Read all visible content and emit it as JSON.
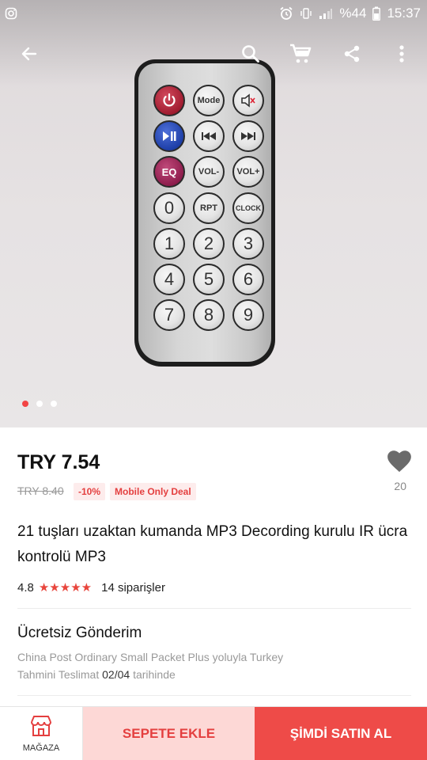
{
  "status_bar": {
    "battery_text": "%44",
    "time": "15:37",
    "icons": [
      "instagram-icon",
      "alarm-icon",
      "vibrate-icon",
      "signal-icon",
      "battery-icon"
    ]
  },
  "nav": {
    "icons": [
      "back-arrow-icon",
      "search-icon",
      "cart-icon",
      "share-icon",
      "more-vert-icon"
    ]
  },
  "gallery": {
    "page_count": 3,
    "active_index": 0,
    "remote_labels": {
      "mode": "Mode",
      "eq": "EQ",
      "vol_minus": "VOL-",
      "vol_plus": "VOL+",
      "zero": "0",
      "rpt": "RPT",
      "clock": "CLOCK",
      "n1": "1",
      "n2": "2",
      "n3": "3",
      "n4": "4",
      "n5": "5",
      "n6": "6",
      "n7": "7",
      "n8": "8",
      "n9": "9"
    }
  },
  "product": {
    "price": "TRY 7.54",
    "old_price": "TRY 8.40",
    "discount": "-10%",
    "deal_badge": "Mobile Only Deal",
    "wishlist_count": "20",
    "title": "21 tuşları uzaktan kumanda MP3 Decording kurulu IR ücra kontrolü MP3",
    "rating": "4.8",
    "stars": "★★★★★",
    "orders": "14 siparişler"
  },
  "shipping": {
    "title": "Ücretsiz Gönderim",
    "method": "China Post Ordinary Small Packet Plus yoluyla Turkey",
    "eta_prefix": "Tahmini Teslimat",
    "eta_date": "02/04",
    "eta_suffix": "tarihinde"
  },
  "bottom_bar": {
    "store_label": "MAĞAZA",
    "add_to_cart": "SEPETE EKLE",
    "buy_now": "ŞİMDİ SATIN AL"
  },
  "colors": {
    "accent": "#ee4b48",
    "cart_bg": "#fdd8d6",
    "star": "#e8453c",
    "dot_active": "#f24444"
  }
}
